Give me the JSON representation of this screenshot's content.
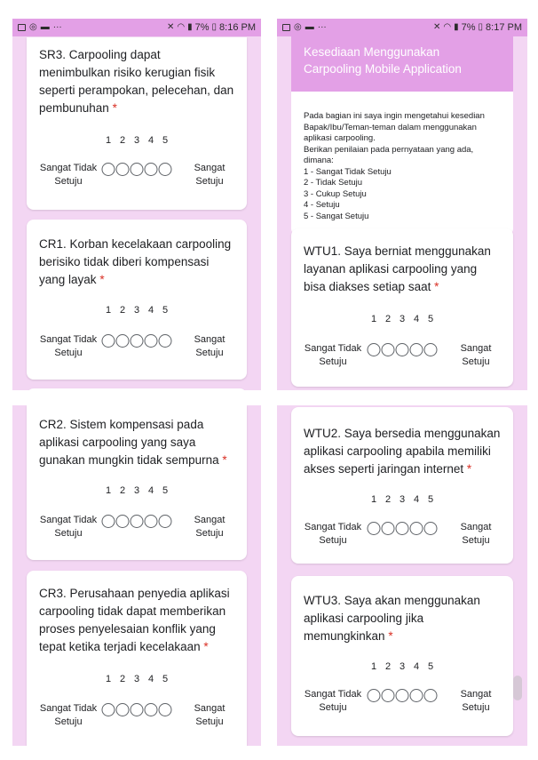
{
  "screens": [
    {
      "status": {
        "time": "8:16 PM",
        "battery": "7%"
      }
    },
    {
      "status": {
        "time": "8:17 PM",
        "battery": "7%"
      }
    },
    {
      "status": {
        "time": "",
        "battery": ""
      }
    },
    {
      "status": {
        "time": "",
        "battery": ""
      }
    }
  ],
  "scale": {
    "numbers": [
      "1",
      "2",
      "3",
      "4",
      "5"
    ],
    "left_label": "Sangat Tidak Setuju",
    "right_label": "Sangat Setuju",
    "required_mark": "*"
  },
  "section_header": {
    "title": "Kesediaan Menggunakan Carpooling Mobile Application",
    "description": [
      "Pada bagian ini saya ingin mengetahui kesedian",
      "Bapak/Ibu/Teman-teman dalam menggunakan",
      "aplikasi carpooling.",
      "Berikan penilaian pada pernyataan yang ada,",
      "dimana:",
      "1 - Sangat Tidak Setuju",
      "2 - Tidak Setuju",
      "3 - Cukup Setuju",
      "4 - Setuju",
      "5 - Sangat Setuju"
    ]
  },
  "questions": {
    "sr3": "SR3. Carpooling dapat menimbulkan risiko kerugian fisik seperti perampokan, pelecehan, dan pembunuhan",
    "cr1": "CR1. Korban kecelakaan carpooling berisiko tidak diberi kompensasi yang layak",
    "cr2": "CR2. Sistem kompensasi pada aplikasi carpooling yang saya gunakan mungkin tidak sempurna",
    "cr3": "CR3. Perusahaan penyedia aplikasi carpooling tidak dapat memberikan proses penyelesaian konflik yang tepat ketika terjadi kecelakaan",
    "wtu1": "WTU1. Saya berniat menggunakan layanan aplikasi carpooling yang bisa diakses setiap saat",
    "wtu2": "WTU2. Saya bersedia menggunakan aplikasi carpooling apabila memiliki akses seperti jaringan internet",
    "wtu3": "WTU3. Saya akan menggunakan aplikasi carpooling jika memungkinkan"
  }
}
